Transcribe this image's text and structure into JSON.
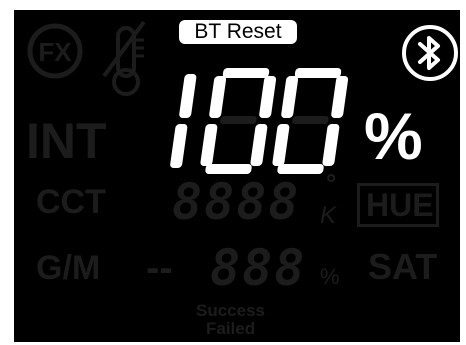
{
  "display": {
    "bt_reset_label": "BT Reset",
    "fx_label": "FX",
    "intensity_label": "INT",
    "intensity_value": "100",
    "intensity_unit": "%",
    "cct_label": "CCT",
    "cct_digits": "8888",
    "cct_unit": "K",
    "gm_label": "G/M",
    "gm_digits": "888",
    "gm_unit": "%",
    "hue_label": "HUE",
    "sat_label": "SAT",
    "status_success": "Success",
    "status_failed": "Failed"
  },
  "icons": {
    "bluetooth": "bluetooth-icon",
    "fx": "fx-icon",
    "temperature": "thermometer-off-icon"
  },
  "colors": {
    "background": "#000000",
    "active": "#ffffff",
    "inactive": "#1c1c1c"
  }
}
